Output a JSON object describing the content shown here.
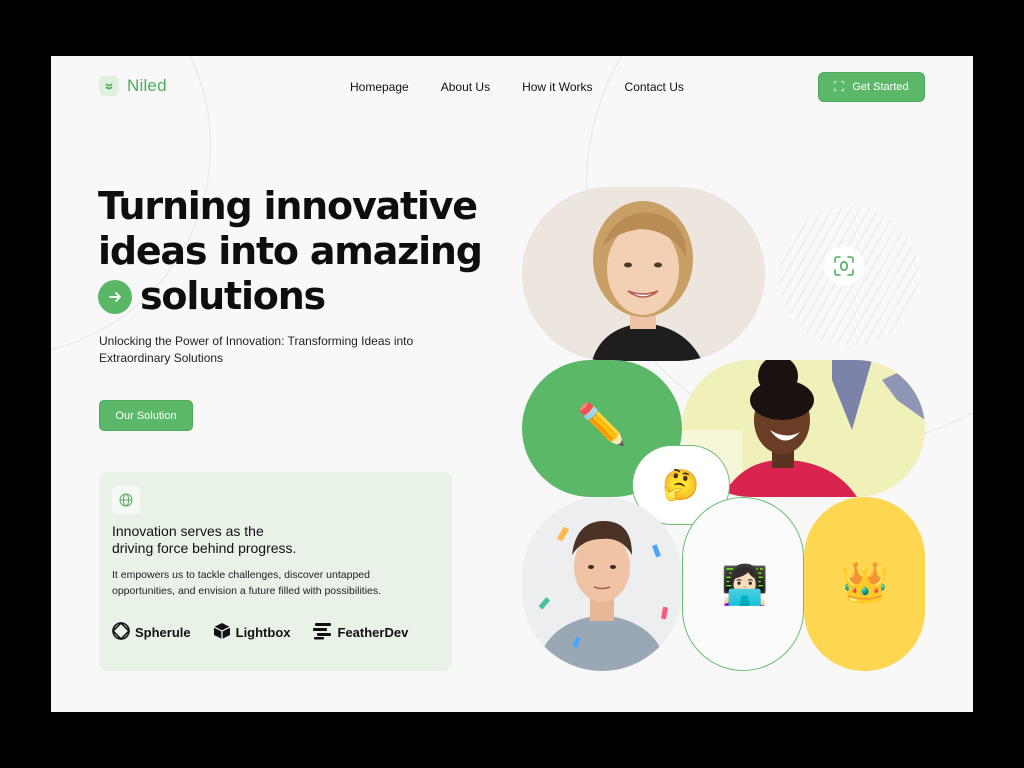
{
  "brand": {
    "name": "Niled"
  },
  "nav": {
    "items": [
      {
        "label": "Homepage"
      },
      {
        "label": "About Us"
      },
      {
        "label": "How it Works"
      },
      {
        "label": "Contact Us"
      }
    ],
    "cta_label": "Get Started"
  },
  "hero": {
    "title_line1": "Turning innovative",
    "title_line2": "ideas into amazing",
    "title_line3": "solutions",
    "subtitle": "Unlocking the Power of Innovation: Transforming Ideas into Extraordinary Solutions",
    "button_label": "Our Solution"
  },
  "info_card": {
    "heading_line1": "Innovation serves as the",
    "heading_line2": "driving force behind progress.",
    "body": "It empowers us to tackle challenges, discover untapped opportunities, and envision a future filled with possibilities.",
    "brands": [
      {
        "name": "Spherule",
        "icon": "spherule-logo-icon"
      },
      {
        "name": "Lightbox",
        "icon": "lightbox-logo-icon"
      },
      {
        "name": "FeatherDev",
        "icon": "featherdev-logo-icon"
      }
    ]
  },
  "collage": {
    "pencil_emoji": "✏️",
    "thinking_emoji": "🤔",
    "laptop_emoji": "👩🏻‍💻",
    "crown_emoji": "👑",
    "scan_icon": "face-scan-icon"
  },
  "colors": {
    "accent": "#5bb868",
    "card_bg": "#e8f2e7",
    "crown_bg": "#ffd64f",
    "page_bg": "#f7f8f7"
  }
}
